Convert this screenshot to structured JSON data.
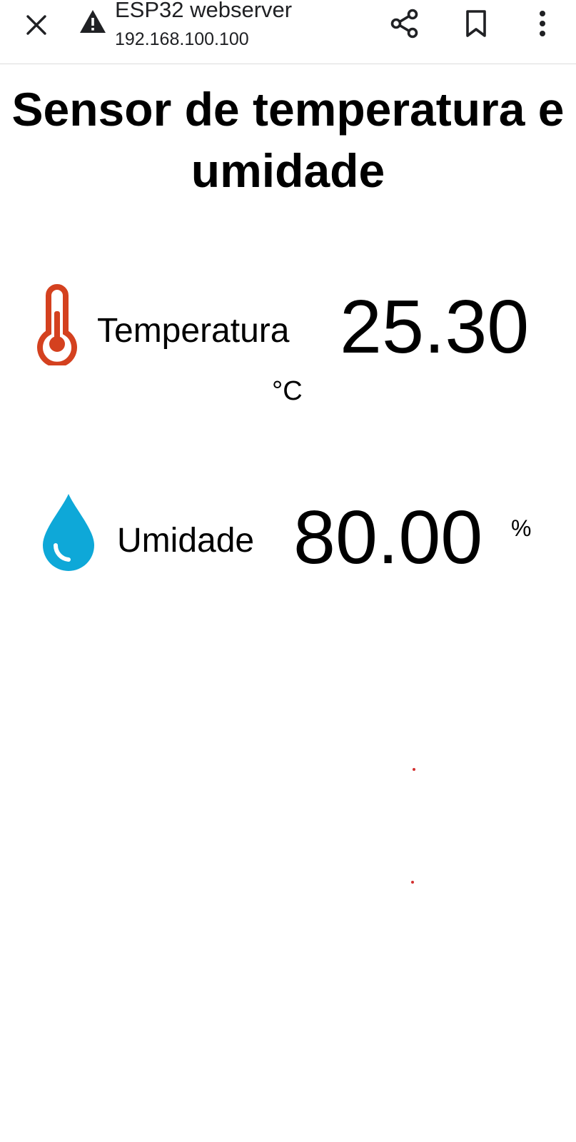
{
  "browser": {
    "page_title": "ESP32 webserver",
    "url": "192.168.100.100",
    "icons": {
      "close": "close-icon",
      "security": "warning-icon",
      "share": "share-icon",
      "bookmark": "bookmark-icon",
      "menu": "more-vert-icon"
    }
  },
  "page": {
    "heading": "Sensor de temperatura e umidade",
    "temperature": {
      "label": "Temperatura",
      "value": "25.30",
      "unit": "°C",
      "icon": "thermometer-icon",
      "icon_color": "#d4411f"
    },
    "humidity": {
      "label": "Umidade",
      "value": "80.00",
      "unit": "%",
      "icon": "water-drop-icon",
      "icon_color": "#0ea8d8"
    }
  }
}
